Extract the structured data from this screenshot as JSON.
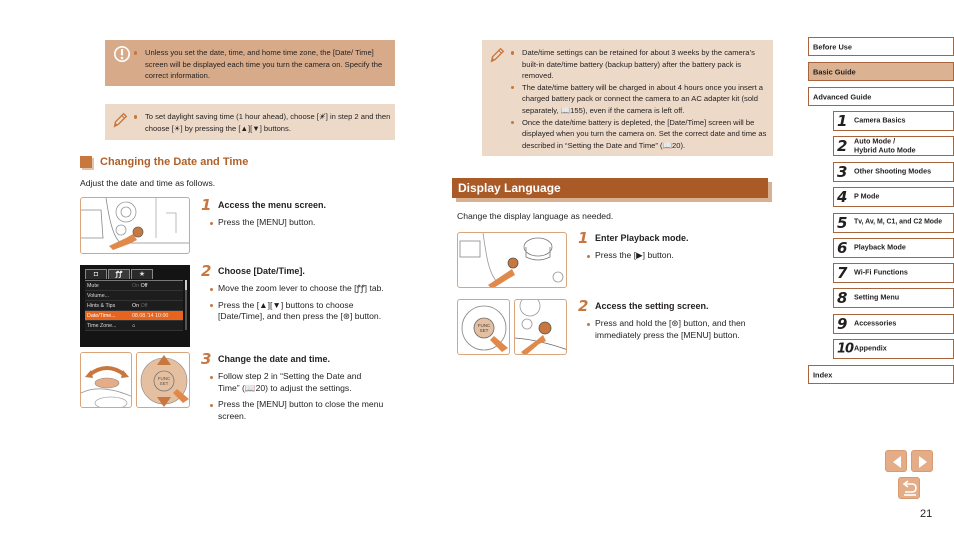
{
  "notes": {
    "warning_left": {
      "icon": "exclamation-circle-icon",
      "items": [
        "Unless you set the date, time, and home time zone, the [Date/ Time] screen will be displayed each time you turn the camera on. Specify the correct information."
      ]
    },
    "tip_left": {
      "icon": "pencil-icon",
      "items": [
        "To set daylight saving time (1 hour ahead), choose [☀̸] in step 2 and then choose [☀] by pressing the [▲][▼] buttons."
      ]
    },
    "tip_right": {
      "icon": "pencil-icon",
      "items": [
        "Date/time settings can be retained for about 3 weeks by the camera’s built-in date/time battery (backup battery) after the battery pack is removed.",
        "The date/time battery will be charged in about 4 hours once you insert a charged battery pack or connect the camera to an AC adapter kit (sold separately, 📖155), even if the camera is left off.",
        "Once the date/time battery is depleted, the [Date/Time] screen will be displayed when you turn the camera on. Set the correct date and time as described in “Setting the Date and Time” (📖20)."
      ]
    }
  },
  "changing": {
    "heading": "Changing the Date and Time",
    "intro": "Adjust the date and time as follows.",
    "steps": [
      {
        "num": "1",
        "title": "Access the menu screen.",
        "bullets": [
          "Press the [MENU] button."
        ]
      },
      {
        "num": "2",
        "title": "Choose [Date/Time].",
        "bullets": [
          "Move the zoom lever to choose the [ꝭꝭ] tab.",
          "Press the [▲][▼] buttons to choose [Date/Time], and then press the [⊛] button."
        ]
      },
      {
        "num": "3",
        "title": "Change the date and time.",
        "bullets": [
          "Follow step 2 in “Setting the Date and Time” (📖20) to adjust the settings.",
          "Press the [MENU] button to close the menu screen."
        ]
      }
    ],
    "camera_screen": {
      "tabs": [
        "◘",
        "ꝭꝭ",
        "★"
      ],
      "active_tab": 1,
      "rows": [
        {
          "key": "Mute",
          "value_dim": "On",
          "value": "Off"
        },
        {
          "key": "Volume...",
          "value_dim": "",
          "value": ""
        },
        {
          "key": "Hints & Tips",
          "value": "On",
          "value_dim": "Off"
        },
        {
          "key": "Date/Time...",
          "value": "08.08.'14 10:00",
          "value_dim": "",
          "selected": true
        },
        {
          "key": "Time Zone...",
          "value": "⌂",
          "value_dim": ""
        }
      ]
    }
  },
  "display_language": {
    "heading": "Display Language",
    "intro": "Change the display language as needed.",
    "steps": [
      {
        "num": "1",
        "title": "Enter Playback mode.",
        "bullets": [
          "Press the [▶] button."
        ]
      },
      {
        "num": "2",
        "title": "Access the setting screen.",
        "bullets": [
          "Press and hold the [⊛] button, and then immediately press the [MENU] button."
        ]
      }
    ]
  },
  "sidebar": {
    "sections": [
      {
        "label": "Before Use",
        "active": false
      },
      {
        "label": "Basic Guide",
        "active": true
      },
      {
        "label": "Advanced Guide",
        "active": false
      }
    ],
    "chapters": [
      {
        "num": "1",
        "label": "Camera Basics"
      },
      {
        "num": "2",
        "label": "Auto Mode /\nHybrid Auto Mode"
      },
      {
        "num": "3",
        "label": "Other Shooting Modes"
      },
      {
        "num": "4",
        "label": "P Mode"
      },
      {
        "num": "5",
        "label": "Tv, Av, M, C1, and C2 Mode"
      },
      {
        "num": "6",
        "label": "Playback Mode"
      },
      {
        "num": "7",
        "label": "Wi-Fi Functions"
      },
      {
        "num": "8",
        "label": "Setting Menu"
      },
      {
        "num": "9",
        "label": "Accessories"
      },
      {
        "num": "10",
        "label": "Appendix"
      }
    ],
    "index_label": "Index"
  },
  "nav": {
    "prev": "previous-page",
    "next": "next-page",
    "back": "return"
  },
  "page_number": "21",
  "colors": {
    "accent": "#c8773e",
    "header_bar": "#a95a27",
    "warning_bg": "#d7ab8a",
    "tip_bg": "#ecd9c8",
    "sidebar_active": "#dbb392"
  }
}
